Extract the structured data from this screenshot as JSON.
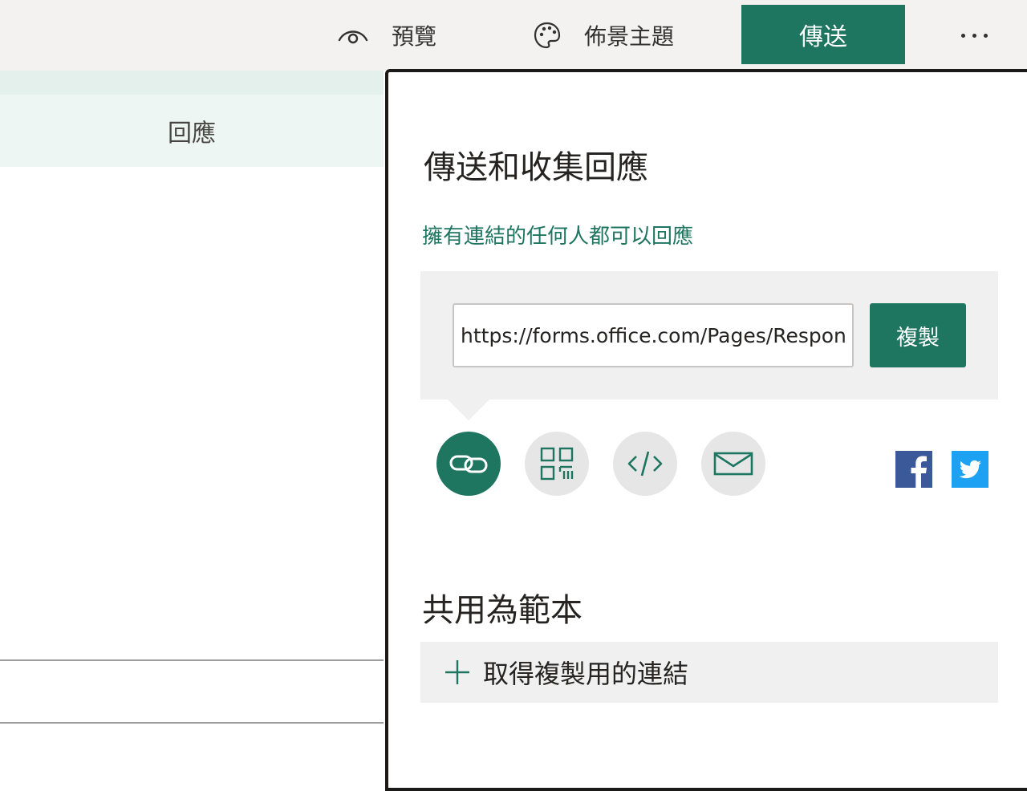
{
  "toolbar": {
    "preview_label": "預覽",
    "theme_label": "佈景主題",
    "send_label": "傳送",
    "preview_icon": "eye-icon",
    "theme_icon": "palette-icon",
    "more_icon": "more-icon"
  },
  "left_pane": {
    "responses_tab": "回應"
  },
  "send_panel": {
    "title": "傳送和收集回應",
    "access_link": "擁有連結的任何人都可以回應",
    "url_value": "https://forms.office.com/Pages/Respon",
    "copy_label": "複製",
    "share_options": [
      {
        "id": "link",
        "icon": "link-icon",
        "active": true
      },
      {
        "id": "qr",
        "icon": "qr-code-icon",
        "active": false
      },
      {
        "id": "embed",
        "icon": "code-icon",
        "active": false
      },
      {
        "id": "email",
        "icon": "mail-icon",
        "active": false
      }
    ],
    "social": [
      {
        "id": "facebook",
        "icon": "facebook-icon",
        "color": "#3b5998"
      },
      {
        "id": "twitter",
        "icon": "twitter-icon",
        "color": "#1da1f2"
      }
    ],
    "template_title": "共用為範本",
    "template_link_label": "取得複製用的連結",
    "accent_color": "#1e7560"
  }
}
